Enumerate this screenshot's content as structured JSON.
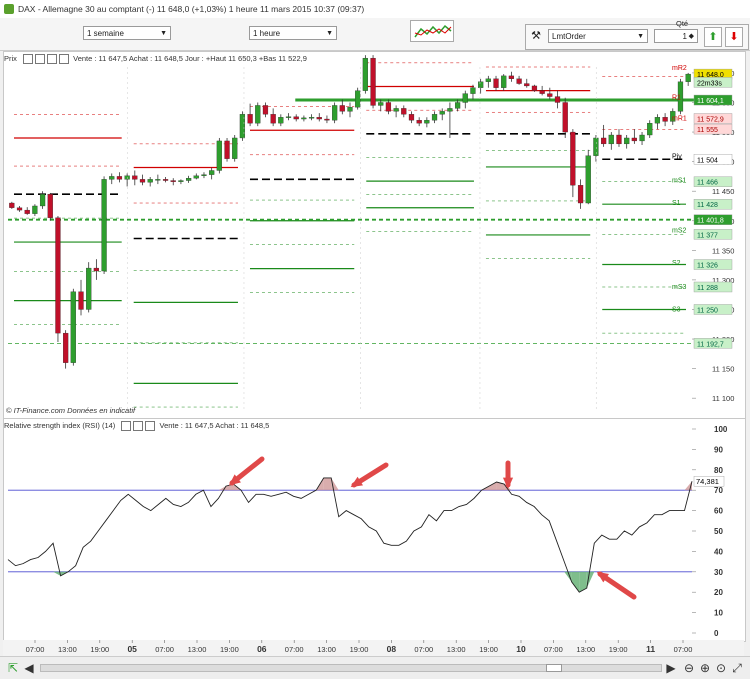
{
  "titlebar": {
    "text": "DAX - Allemagne 30 au comptant (-)    11 648,0 (+1,03%)    1 heure  11 mars 2015 10:37 (09:37)"
  },
  "toolbar": {
    "range_select": "1 semaine",
    "interval_select": "1 heure",
    "qty_label": "Qté",
    "order_type": "LmtOrder",
    "quantity": "1"
  },
  "price_panel": {
    "header_label": "Prix",
    "header_info": "Vente : 11 647,5  Achat : 11 648,5  Jour : +Haut 11 650,3 +Bas 11 522,9",
    "watermark": "© IT-Finance.com  Données en indicatif",
    "y_ticks": [
      "11 650",
      "11 600",
      "11 550",
      "11 500",
      "11 450",
      "11 400",
      "11 350",
      "11 300",
      "11 250",
      "11 200",
      "11 150",
      "11 100"
    ],
    "pivot_tags": [
      {
        "text": "mR2",
        "color": "#d00000"
      },
      {
        "text": "R1",
        "color": "#d00000"
      },
      {
        "text": "mR1",
        "color": "#d00000"
      },
      {
        "text": "Piv",
        "color": "#000000"
      },
      {
        "text": "mS1",
        "color": "#1a8a1a"
      },
      {
        "text": "S1",
        "color": "#1a8a1a"
      },
      {
        "text": "mS2",
        "color": "#1a8a1a"
      },
      {
        "text": "S2",
        "color": "#1a8a1a"
      },
      {
        "text": "mS3",
        "color": "#1a8a1a"
      },
      {
        "text": "S3",
        "color": "#1a8a1a"
      }
    ],
    "value_boxes": [
      {
        "text": "11 648,0",
        "bg": "#f0e000",
        "fg": "#000"
      },
      {
        "text": "22m33s",
        "bg": "#c8f0c8",
        "fg": "#000"
      },
      {
        "text": "11 604,1",
        "bg": "#2e9e2e",
        "fg": "#fff"
      },
      {
        "text": "11 572,9",
        "bg": "#ffd8d8",
        "fg": "#a00"
      },
      {
        "text": "11 555",
        "bg": "#ffd8d8",
        "fg": "#a00"
      },
      {
        "text": "11 504",
        "bg": "#ffffff",
        "fg": "#000"
      },
      {
        "text": "11 466",
        "bg": "#c8f0c8",
        "fg": "#064"
      },
      {
        "text": "11 428",
        "bg": "#c8f0c8",
        "fg": "#064"
      },
      {
        "text": "11 401,8",
        "bg": "#2e9e2e",
        "fg": "#fff"
      },
      {
        "text": "11 377",
        "bg": "#c8f0c8",
        "fg": "#064"
      },
      {
        "text": "11 326",
        "bg": "#c8f0c8",
        "fg": "#064"
      },
      {
        "text": "11 288",
        "bg": "#c8f0c8",
        "fg": "#064"
      },
      {
        "text": "11 250",
        "bg": "#c8f0c8",
        "fg": "#064"
      },
      {
        "text": "11 192,7",
        "bg": "#c8f0c8",
        "fg": "#064"
      }
    ]
  },
  "rsi_panel": {
    "header_label": "Relative strength index (RSI) (14)",
    "header_info": "Vente : 11 647,5  Achat : 11 648,5",
    "y_ticks": [
      "100",
      "90",
      "80",
      "70",
      "60",
      "50",
      "40",
      "30",
      "20",
      "10",
      "0"
    ],
    "current_value": "74,381",
    "overbought": 70,
    "oversold": 30
  },
  "x_axis": {
    "labels": [
      "07:00",
      "13:00",
      "19:00",
      "05",
      "07:00",
      "13:00",
      "19:00",
      "06",
      "07:00",
      "13:00",
      "19:00",
      "08",
      "07:00",
      "13:00",
      "19:00",
      "10",
      "07:00",
      "13:00",
      "19:00",
      "11",
      "07:00"
    ],
    "major": [
      "05",
      "06",
      "08",
      "10",
      "11"
    ]
  },
  "chart_data": [
    {
      "type": "candlestick",
      "title": "DAX - Allemagne 30 au comptant (-)",
      "ylim": [
        11080,
        11660
      ],
      "candles": [
        [
          11430,
          11432,
          11420,
          11422
        ],
        [
          11422,
          11425,
          11415,
          11418
        ],
        [
          11418,
          11423,
          11410,
          11412
        ],
        [
          11412,
          11428,
          11408,
          11425
        ],
        [
          11425,
          11450,
          11420,
          11445
        ],
        [
          11445,
          11447,
          11400,
          11405
        ],
        [
          11405,
          11408,
          11195,
          11210
        ],
        [
          11210,
          11215,
          11150,
          11160
        ],
        [
          11160,
          11285,
          11155,
          11280
        ],
        [
          11280,
          11300,
          11240,
          11250
        ],
        [
          11250,
          11330,
          11245,
          11320
        ],
        [
          11320,
          11335,
          11300,
          11315
        ],
        [
          11315,
          11475,
          11310,
          11470
        ],
        [
          11470,
          11480,
          11462,
          11475
        ],
        [
          11475,
          11482,
          11465,
          11470
        ],
        [
          11470,
          11480,
          11458,
          11476
        ],
        [
          11476,
          11485,
          11460,
          11470
        ],
        [
          11470,
          11478,
          11460,
          11465
        ],
        [
          11465,
          11474,
          11458,
          11470
        ],
        [
          11470,
          11478,
          11462,
          11470
        ],
        [
          11470,
          11474,
          11465,
          11468
        ],
        [
          11468,
          11472,
          11460,
          11466
        ],
        [
          11466,
          11470,
          11462,
          11468
        ],
        [
          11468,
          11476,
          11464,
          11472
        ],
        [
          11472,
          11480,
          11470,
          11476
        ],
        [
          11476,
          11482,
          11472,
          11478
        ],
        [
          11478,
          11490,
          11470,
          11485
        ],
        [
          11485,
          11540,
          11480,
          11535
        ],
        [
          11535,
          11540,
          11500,
          11505
        ],
        [
          11505,
          11545,
          11500,
          11540
        ],
        [
          11540,
          11585,
          11535,
          11580
        ],
        [
          11580,
          11598,
          11560,
          11565
        ],
        [
          11565,
          11600,
          11560,
          11595
        ],
        [
          11595,
          11600,
          11575,
          11580
        ],
        [
          11580,
          11590,
          11560,
          11565
        ],
        [
          11565,
          11580,
          11560,
          11575
        ],
        [
          11575,
          11582,
          11570,
          11576
        ],
        [
          11576,
          11580,
          11568,
          11572
        ],
        [
          11572,
          11578,
          11568,
          11574
        ],
        [
          11574,
          11580,
          11570,
          11575
        ],
        [
          11575,
          11582,
          11568,
          11572
        ],
        [
          11572,
          11578,
          11565,
          11570
        ],
        [
          11570,
          11600,
          11565,
          11595
        ],
        [
          11595,
          11605,
          11580,
          11585
        ],
        [
          11585,
          11600,
          11575,
          11592
        ],
        [
          11592,
          11625,
          11588,
          11620
        ],
        [
          11620,
          11680,
          11615,
          11675
        ],
        [
          11675,
          11680,
          11590,
          11595
        ],
        [
          11595,
          11605,
          11585,
          11600
        ],
        [
          11600,
          11605,
          11580,
          11585
        ],
        [
          11585,
          11595,
          11575,
          11590
        ],
        [
          11590,
          11595,
          11575,
          11580
        ],
        [
          11580,
          11585,
          11565,
          11570
        ],
        [
          11570,
          11575,
          11560,
          11565
        ],
        [
          11565,
          11575,
          11558,
          11570
        ],
        [
          11570,
          11585,
          11565,
          11580
        ],
        [
          11580,
          11590,
          11570,
          11585
        ],
        [
          11585,
          11600,
          11540,
          11590
        ],
        [
          11590,
          11605,
          11585,
          11600
        ],
        [
          11600,
          11620,
          11590,
          11615
        ],
        [
          11615,
          11630,
          11605,
          11625
        ],
        [
          11625,
          11640,
          11615,
          11635
        ],
        [
          11635,
          11645,
          11625,
          11640
        ],
        [
          11640,
          11645,
          11620,
          11625
        ],
        [
          11625,
          11648,
          11620,
          11645
        ],
        [
          11645,
          11652,
          11635,
          11640
        ],
        [
          11640,
          11645,
          11630,
          11632
        ],
        [
          11632,
          11640,
          11625,
          11628
        ],
        [
          11628,
          11630,
          11618,
          11620
        ],
        [
          11620,
          11628,
          11612,
          11615
        ],
        [
          11615,
          11625,
          11605,
          11610
        ],
        [
          11610,
          11620,
          11590,
          11600
        ],
        [
          11600,
          11608,
          11540,
          11550
        ],
        [
          11550,
          11555,
          11440,
          11460
        ],
        [
          11460,
          11470,
          11420,
          11430
        ],
        [
          11430,
          11520,
          11428,
          11510
        ],
        [
          11510,
          11545,
          11500,
          11540
        ],
        [
          11540,
          11562,
          11525,
          11530
        ],
        [
          11530,
          11550,
          11520,
          11545
        ],
        [
          11545,
          11555,
          11525,
          11530
        ],
        [
          11530,
          11545,
          11522,
          11540
        ],
        [
          11540,
          11555,
          11530,
          11535
        ],
        [
          11535,
          11550,
          11528,
          11545
        ],
        [
          11545,
          11570,
          11540,
          11565
        ],
        [
          11565,
          11580,
          11555,
          11575
        ],
        [
          11575,
          11582,
          11560,
          11568
        ],
        [
          11568,
          11590,
          11562,
          11585
        ],
        [
          11585,
          11640,
          11580,
          11635
        ],
        [
          11635,
          11650,
          11628,
          11648
        ]
      ],
      "levels": [
        {
          "segment": 0,
          "x_range": [
            0,
            0.175
          ],
          "values": [
            {
              "v": 11540,
              "kind": "R"
            },
            {
              "v": 11445,
              "kind": "Piv"
            },
            {
              "v": 11364,
              "kind": "S"
            },
            {
              "v": 11265,
              "kind": "S"
            }
          ]
        },
        {
          "segment": 1,
          "x_range": [
            0.175,
            0.345
          ],
          "values": [
            {
              "v": 11490,
              "kind": "R"
            },
            {
              "v": 11370,
              "kind": "Piv"
            },
            {
              "v": 11262,
              "kind": "S"
            },
            {
              "v": 11125,
              "kind": "S"
            }
          ]
        },
        {
          "segment": 2,
          "x_range": [
            0.345,
            0.515
          ],
          "values": [
            {
              "v": 11553,
              "kind": "R"
            },
            {
              "v": 11470,
              "kind": "Piv"
            },
            {
              "v": 11400,
              "kind": "S"
            },
            {
              "v": 11319,
              "kind": "S"
            }
          ]
        },
        {
          "segment": 3,
          "x_range": [
            0.515,
            0.69
          ],
          "values": [
            {
              "v": 11627,
              "kind": "R"
            },
            {
              "v": 11547,
              "kind": "Piv"
            },
            {
              "v": 11467,
              "kind": "S"
            },
            {
              "v": 11422,
              "kind": "S"
            }
          ]
        },
        {
          "segment": 4,
          "x_range": [
            0.69,
            0.86
          ],
          "values": [
            {
              "v": 11620,
              "kind": "R"
            },
            {
              "v": 11547,
              "kind": "Piv"
            },
            {
              "v": 11491,
              "kind": "S"
            },
            {
              "v": 11376,
              "kind": "S"
            }
          ]
        },
        {
          "segment": 5,
          "x_range": [
            0.86,
            1.0
          ],
          "values": [
            {
              "v": 11604,
              "kind": "R"
            },
            {
              "v": 11504,
              "kind": "Piv"
            },
            {
              "v": 11428,
              "kind": "S"
            },
            {
              "v": 11326,
              "kind": "S"
            },
            {
              "v": 11250,
              "kind": "S"
            }
          ]
        }
      ],
      "horizontal_lines": [
        {
          "v": 11604.1,
          "color": "#2e9e2e",
          "style": "solid-thick"
        },
        {
          "v": 11401.8,
          "color": "#2e9e2e",
          "style": "dashed-thick"
        },
        {
          "v": 11192.7,
          "color": "#2e9e2e",
          "style": "dashed-thin"
        }
      ]
    },
    {
      "type": "line",
      "title": "Relative strength index (RSI) (14)",
      "ylim": [
        0,
        100
      ],
      "bands": [
        30,
        70
      ],
      "values": [
        36,
        33,
        34,
        36,
        37,
        40,
        44,
        28,
        30,
        33,
        42,
        45,
        50,
        55,
        60,
        65,
        68,
        65,
        62,
        60,
        63,
        66,
        63,
        62,
        64,
        68,
        70,
        62,
        66,
        72,
        73,
        70,
        64,
        68,
        68,
        67,
        68,
        69,
        67,
        66,
        68,
        70,
        76,
        76,
        57,
        60,
        58,
        56,
        52,
        50,
        44,
        43,
        43,
        45,
        50,
        52,
        58,
        55,
        60,
        60,
        62,
        63,
        66,
        70,
        72,
        74,
        73,
        68,
        67,
        64,
        62,
        58,
        55,
        45,
        35,
        25,
        20,
        22,
        44,
        48,
        46,
        46,
        50,
        48,
        52,
        54,
        58,
        58,
        60,
        60,
        60,
        74.4
      ]
    }
  ]
}
